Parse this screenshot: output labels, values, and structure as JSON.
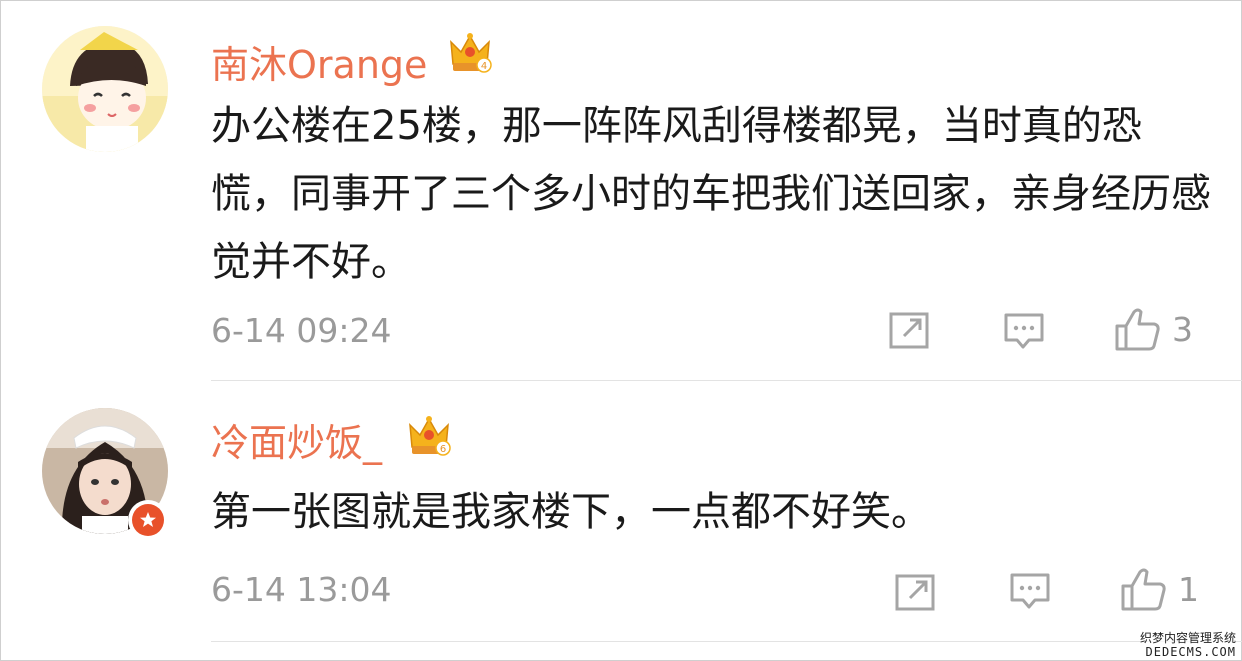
{
  "colors": {
    "username": "#eb7350",
    "body_text": "#1a1a1a",
    "meta_text": "#9a9a9a",
    "divider": "#e3e3e3",
    "crown_gold": "#f5b21c",
    "vip_red": "#e8512a"
  },
  "comments": [
    {
      "username": "南沐Orange",
      "badge_icon": "crown-icon",
      "badge_level": "4",
      "text": "办公楼在25楼，那一阵阵风刮得楼都晃，当时真的恐慌，同事开了三个多小时的车把我们送回家，亲身经历感觉并不好。",
      "timestamp": "6-14 09:24",
      "share_icon": "share-icon",
      "reply_icon": "comment-icon",
      "like_icon": "thumbs-up-icon",
      "like_count": "3"
    },
    {
      "username": "冷面炒饭_",
      "badge_icon": "crown-icon",
      "badge_level": "6",
      "verified_icon": "star-badge-icon",
      "text": "第一张图就是我家楼下，一点都不好笑。",
      "timestamp": "6-14 13:04",
      "share_icon": "share-icon",
      "reply_icon": "comment-icon",
      "like_icon": "thumbs-up-icon",
      "like_count": "1"
    }
  ],
  "watermark": {
    "line1": "织梦内容管理系统",
    "line2": "DEDECMS.COM"
  }
}
